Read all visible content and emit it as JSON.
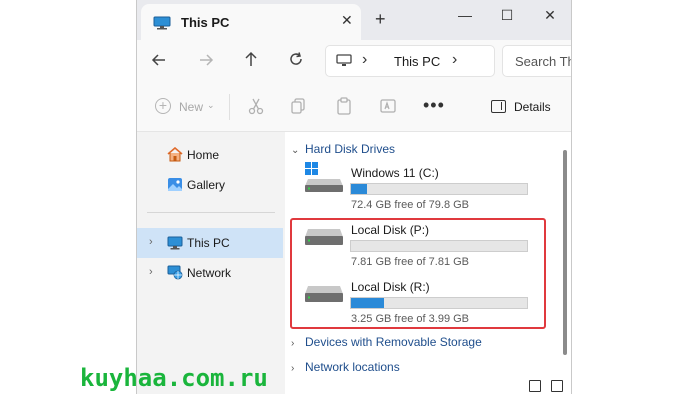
{
  "window": {
    "tab_title": "This PC",
    "close_tab_glyph": "✕",
    "new_tab_glyph": "+",
    "minimize_glyph": "—",
    "maximize_glyph": "☐",
    "close_glyph": "✕"
  },
  "nav": {
    "back_icon": "arrow-left-icon",
    "forward_icon": "arrow-right-icon",
    "up_icon": "arrow-up-icon",
    "refresh_icon": "refresh-icon",
    "address_chevron": "›",
    "address_text": "This PC",
    "search_placeholder": "Search Th"
  },
  "toolbar": {
    "new_label": "New",
    "new_chevron": "⌄",
    "more_glyph": "•••",
    "details_label": "Details"
  },
  "sidebar": {
    "items": [
      {
        "label": "Home",
        "icon": "home-icon"
      },
      {
        "label": "Gallery",
        "icon": "gallery-icon"
      },
      {
        "label": "This PC",
        "icon": "computer-icon",
        "selected": true
      },
      {
        "label": "Network",
        "icon": "network-icon"
      }
    ],
    "chevron": "›"
  },
  "content": {
    "group_chevron_open": "⌄",
    "group_chevron_closed": "›",
    "groups": {
      "hard_disk_drives": "Hard Disk Drives",
      "removable_storage": "Devices with Removable Storage",
      "network_locations": "Network locations"
    },
    "drives": [
      {
        "name": "Windows 11 (C:)",
        "free_text": "72.4 GB free of 79.8 GB",
        "used_fraction": 0.09,
        "icon": "windows-drive-icon"
      },
      {
        "name": "Local Disk (P:)",
        "free_text": "7.81 GB free of 7.81 GB",
        "used_fraction": 0.0,
        "icon": "drive-icon"
      },
      {
        "name": "Local Disk (R:)",
        "free_text": "3.25 GB free of 3.99 GB",
        "used_fraction": 0.19,
        "icon": "drive-icon"
      }
    ]
  },
  "colors": {
    "accent": "#2b8ad8",
    "highlight": "#e0393e",
    "selected_bg": "#cfe3f7",
    "watermark": "#1ab53c"
  },
  "watermark": "kuyhaa.com.ru"
}
